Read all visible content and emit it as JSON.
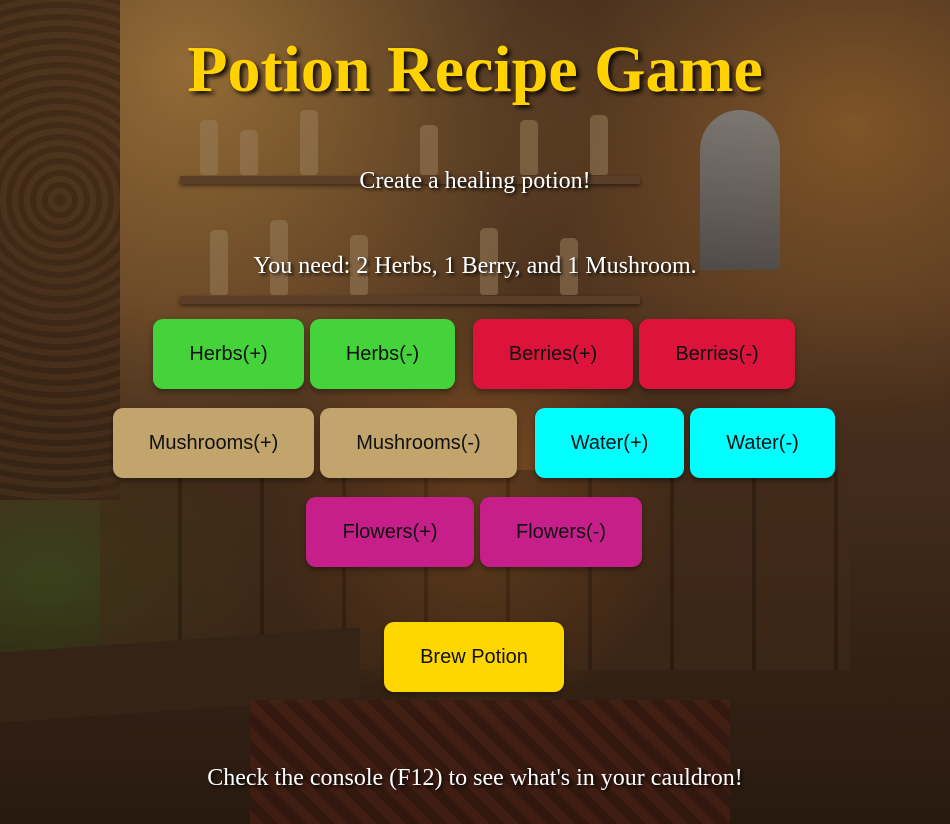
{
  "title": "Potion Recipe Game",
  "task": "Create a healing potion!",
  "requirement": "You need: 2 Herbs, 1 Berry, and 1 Mushroom.",
  "ingredients": {
    "herbs": {
      "add": "Herbs(+)",
      "remove": "Herbs(-)",
      "color": "#45d33b"
    },
    "berries": {
      "add": "Berries(+)",
      "remove": "Berries(-)",
      "color": "#dc143c"
    },
    "mushrooms": {
      "add": "Mushrooms(+)",
      "remove": "Mushrooms(-)",
      "color": "#c2a56d"
    },
    "water": {
      "add": "Water(+)",
      "remove": "Water(-)",
      "color": "#00ffff"
    },
    "flowers": {
      "add": "Flowers(+)",
      "remove": "Flowers(-)",
      "color": "#c71f8a"
    }
  },
  "brew": {
    "label": "Brew Potion",
    "color": "#ffd700"
  },
  "footer": "Check the console (F12) to see what's in your cauldron!"
}
